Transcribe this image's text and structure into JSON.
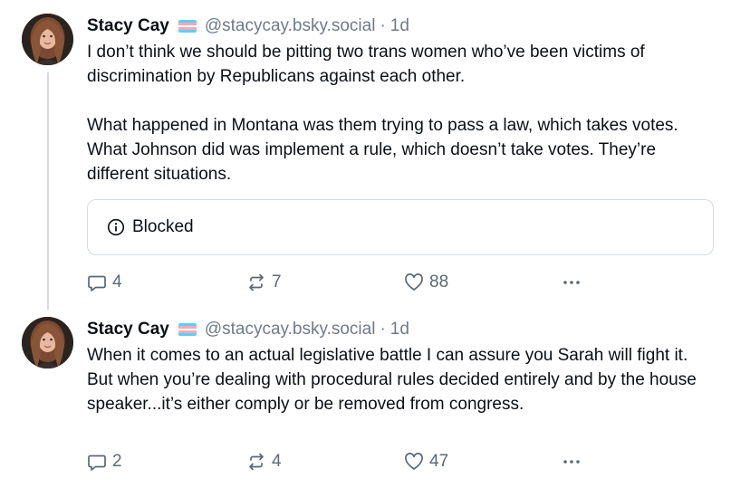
{
  "posts": [
    {
      "author": {
        "display_name": "Stacy Cay",
        "handle": "@stacycay.bsky.social",
        "flag": "trans-flag"
      },
      "separator": "·",
      "time": "1d",
      "paragraphs": [
        "I don’t think we should be pitting two trans women who’ve been victims of discrimination by Republicans against each other.",
        "What happened in Montana was them trying to pass a law, which takes votes. What Johnson did was implement a rule, which doesn’t take votes. They’re different situations."
      ],
      "embed": {
        "icon": "info-circle-icon",
        "label": "Blocked"
      },
      "counts": {
        "replies": "4",
        "reposts": "7",
        "likes": "88"
      }
    },
    {
      "author": {
        "display_name": "Stacy Cay",
        "handle": "@stacycay.bsky.social",
        "flag": "trans-flag"
      },
      "separator": "·",
      "time": "1d",
      "paragraphs": [
        "When it comes to an actual legislative battle I can assure you Sarah will fight it. But when you’re dealing with procedural rules decided entirely and by the house speaker...it’s either comply or be removed from congress."
      ],
      "counts": {
        "replies": "2",
        "reposts": "4",
        "likes": "47"
      }
    }
  ],
  "colors": {
    "text": "#0b0f14",
    "muted": "#6f7b88",
    "border": "#d4dbe2",
    "flag_blue": "#5bcefa",
    "flag_pink": "#f5a9b8",
    "flag_white": "#ffffff"
  }
}
